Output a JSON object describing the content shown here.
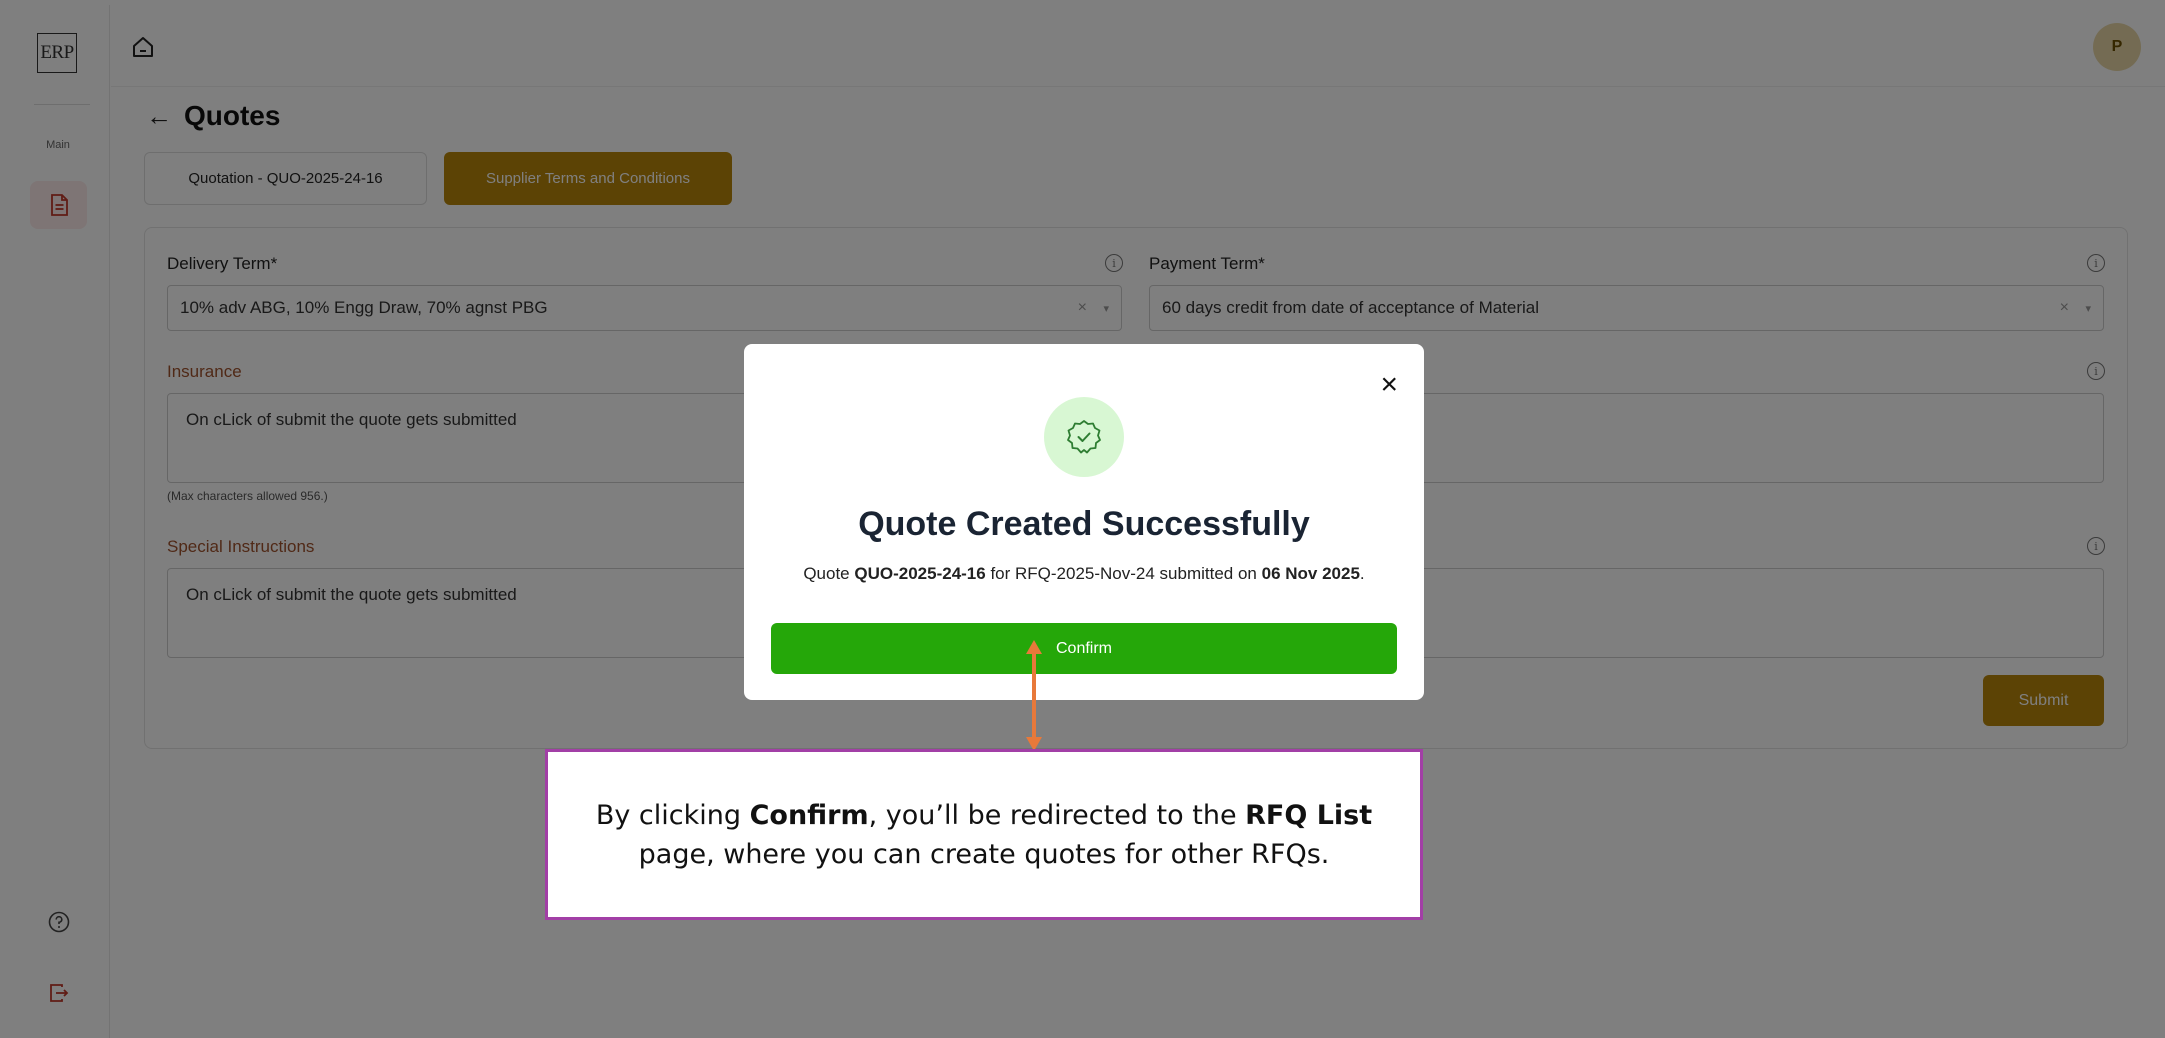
{
  "app": {
    "logo_text": "ERP"
  },
  "sidebar": {
    "section_label": "Main",
    "items": [
      {
        "name": "document",
        "icon": "document-icon",
        "active": true
      }
    ],
    "help_icon": "help-icon",
    "logout_icon": "logout-icon"
  },
  "topbar": {
    "home_icon": "home-icon",
    "avatar_initial": "P"
  },
  "page": {
    "back_arrow": "←",
    "title": "Quotes",
    "tabs": [
      {
        "label": "Quotation - QUO-2025-24-16",
        "active": false
      },
      {
        "label": "Supplier Terms and Conditions",
        "active": true
      }
    ]
  },
  "form": {
    "delivery_term": {
      "label": "Delivery Term*",
      "value": "10% adv ABG, 10% Engg Draw, 70% agnst PBG"
    },
    "payment_term": {
      "label": "Payment Term*",
      "value": "60 days credit from date of acceptance of Material"
    },
    "insurance": {
      "label": "Insurance",
      "value": "On cLick of submit the quote gets submitted",
      "hint": "(Max characters allowed 956.)"
    },
    "special_instructions": {
      "label": "Special Instructions",
      "value": "On cLick of submit the quote gets submitted"
    },
    "clear_symbol": "×",
    "caret_symbol": "▾",
    "info_symbol": "i",
    "submit_label": "Submit"
  },
  "modal": {
    "close_symbol": "×",
    "title": "Quote Created Successfully",
    "message_prefix": "Quote ",
    "quote_id": "QUO-2025-24-16",
    "message_middle": " for RFQ-2025-Nov-24 submitted on ",
    "date": "06 Nov 2025",
    "message_suffix": ".",
    "confirm_label": "Confirm"
  },
  "annotation": {
    "part1": "By clicking ",
    "bold1": "Confirm",
    "part2": ", you’ll be redirected to the ",
    "bold2": "RFQ List",
    "part3": " page, where you can create quotes for other RFQs."
  },
  "colors": {
    "brand_gold": "#b8860b",
    "confirm_green": "#25a709",
    "annotation_border": "#a23fa6",
    "arrow": "#e8793a"
  }
}
